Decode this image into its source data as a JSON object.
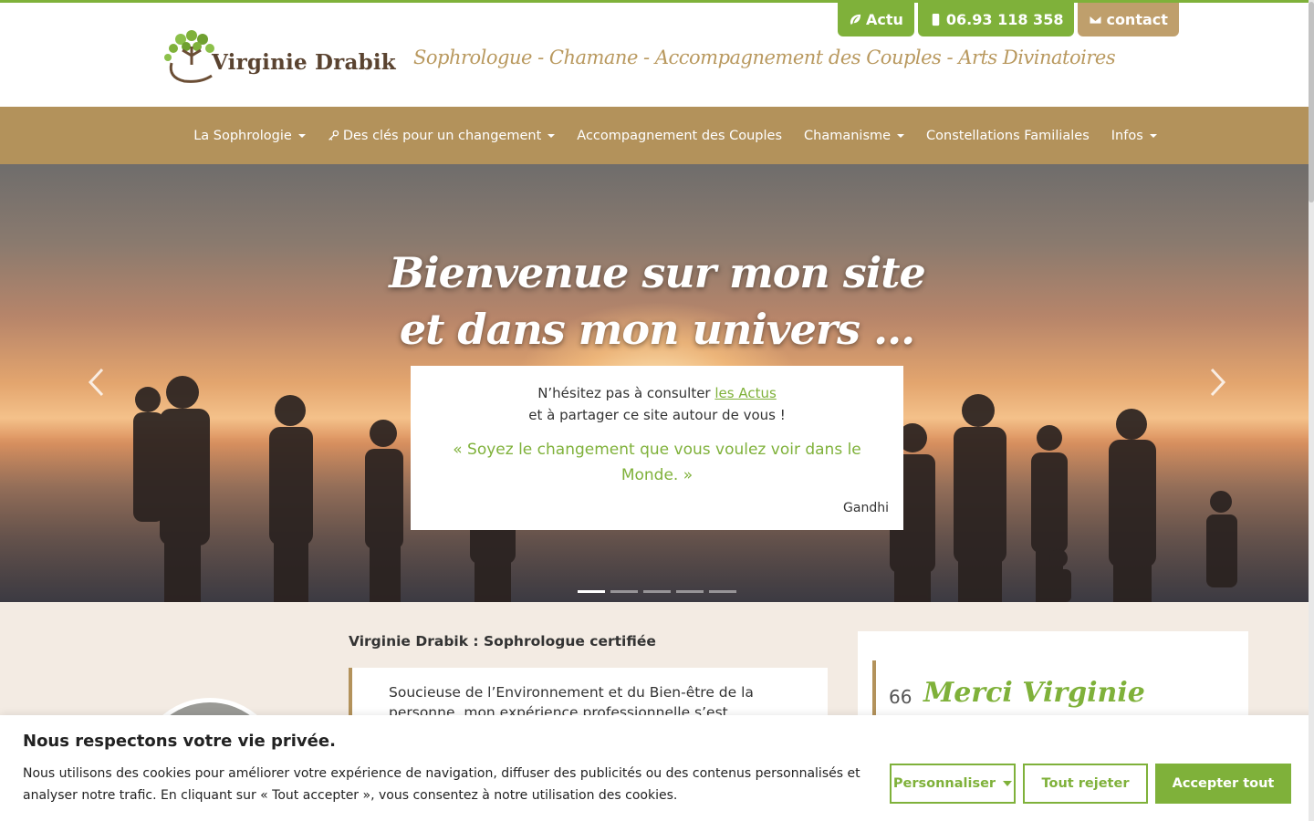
{
  "header": {
    "logo_text": "Virginie Drabik",
    "tagline": "Sophrologue - Chamane - Accompagnement des Couples - Arts Divinatoires",
    "buttons": [
      {
        "label": "Actu",
        "icon": "leaf-icon",
        "color": "#7fb13a"
      },
      {
        "label": "06.93 118 358",
        "icon": "phone-icon",
        "color": "#7fb13a"
      },
      {
        "label": "contact",
        "icon": "envelope-icon",
        "color": "#bf9f6c"
      }
    ]
  },
  "nav": {
    "items": [
      {
        "label": "La Sophrologie",
        "dropdown": true
      },
      {
        "label": "Des clés pour un changement",
        "dropdown": true,
        "icon": "key-icon"
      },
      {
        "label": "Accompagnement des Couples",
        "dropdown": false
      },
      {
        "label": "Chamanisme",
        "dropdown": true
      },
      {
        "label": "Constellations Familiales",
        "dropdown": false
      },
      {
        "label": "Infos",
        "dropdown": true
      }
    ]
  },
  "hero": {
    "title_line1": "Bienvenue sur mon site",
    "title_line2": "et dans mon univers ...",
    "card": {
      "line1_prefix": "N’hésitez pas à consulter ",
      "line1_link": "les Actus",
      "line2": "et à partager ce site autour de vous !",
      "quote": "« Soyez le changement que vous voulez voir dans le Monde. »",
      "author": "Gandhi"
    },
    "slides_count": 5,
    "active_slide": 1
  },
  "content": {
    "section_title": "Virginie Drabik : Sophrologue certifiée",
    "intro_text": "Soucieuse de l’Environnement et du Bien-être de la personne, mon expérience professionnelle s’est articulée",
    "testimonial": {
      "number": "66",
      "title": "Merci Virginie"
    }
  },
  "cookie": {
    "title": "Nous respectons votre vie privée.",
    "text": "Nous utilisons des cookies pour améliorer votre expérience de navigation, diffuser des publicités ou des contenus personnalisés et analyser notre trafic. En cliquant sur « Tout accepter », vous consentez à notre utilisation des cookies.",
    "customize": "Personnaliser",
    "reject": "Tout rejeter",
    "accept": "Accepter tout"
  },
  "colors": {
    "green": "#7fb13a",
    "tan": "#b3925b",
    "cream": "#f3ebe3"
  }
}
